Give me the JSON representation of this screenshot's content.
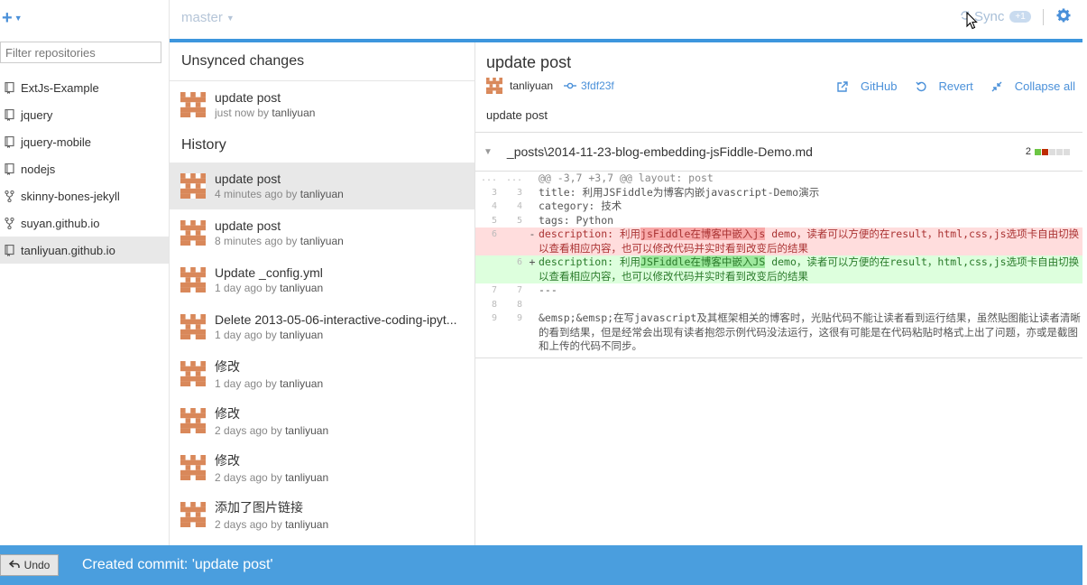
{
  "sidebar": {
    "filter_placeholder": "Filter repositories",
    "repos": [
      {
        "name": "ExtJs-Example",
        "icon": "repo-icon"
      },
      {
        "name": "jquery",
        "icon": "repo-icon"
      },
      {
        "name": "jquery-mobile",
        "icon": "repo-icon"
      },
      {
        "name": "nodejs",
        "icon": "repo-icon"
      },
      {
        "name": "skinny-bones-jekyll",
        "icon": "fork-icon"
      },
      {
        "name": "suyan.github.io",
        "icon": "fork-icon"
      },
      {
        "name": "tanliyuan.github.io",
        "icon": "repo-icon",
        "selected": true
      }
    ]
  },
  "topbar": {
    "branch": "master",
    "sync_label": "Sync",
    "sync_badge": "+1"
  },
  "middle": {
    "unsynced_title": "Unsynced changes",
    "unsynced": {
      "title": "update post",
      "time": "just now",
      "by": "by",
      "author": "tanliyuan"
    },
    "history_title": "History",
    "history": [
      {
        "title": "update post",
        "time": "4 minutes ago",
        "by": "by",
        "author": "tanliyuan",
        "selected": true
      },
      {
        "title": "update post",
        "time": "8 minutes ago",
        "by": "by",
        "author": "tanliyuan"
      },
      {
        "title": "Update _config.yml",
        "time": "1 day ago",
        "by": "by",
        "author": "tanliyuan"
      },
      {
        "title": "Delete 2013-05-06-interactive-coding-ipyt...",
        "time": "1 day ago",
        "by": "by",
        "author": "tanliyuan"
      },
      {
        "title": "修改",
        "time": "1 day ago",
        "by": "by",
        "author": "tanliyuan"
      },
      {
        "title": "修改",
        "time": "2 days ago",
        "by": "by",
        "author": "tanliyuan"
      },
      {
        "title": "修改",
        "time": "2 days ago",
        "by": "by",
        "author": "tanliyuan"
      },
      {
        "title": "添加了图片链接",
        "time": "2 days ago",
        "by": "by",
        "author": "tanliyuan"
      }
    ]
  },
  "detail": {
    "title": "update post",
    "author": "tanliyuan",
    "sha": "3fdf23f",
    "actions": {
      "github": "GitHub",
      "revert": "Revert",
      "collapse": "Collapse all"
    },
    "message": "update post",
    "file": "_posts\\2014-11-23-blog-embedding-jsFiddle-Demo.md",
    "changes": "2",
    "diff": {
      "hunk": "@@ -3,7 +3,7 @@ layout: post",
      "hunk_old": "...",
      "hunk_new": "...",
      "l3": {
        "old": "3",
        "new": "3",
        "code": "title: 利用JSFiddle为博客内嵌javascript-Demo演示"
      },
      "l4": {
        "old": "4",
        "new": "4",
        "code": "category: 技术"
      },
      "l5": {
        "old": "5",
        "new": "5",
        "code": "tags: Python"
      },
      "del": {
        "old": "6",
        "sign": "-",
        "pre": "description: 利用",
        "hl": "jsFiddle在博客中嵌入js",
        "post": " demo，读者可以方便的在result，html,css,js选项卡自由切换以查看相应内容，也可以修改代码并实时看到改变后的结果"
      },
      "add": {
        "new": "6",
        "sign": "+",
        "pre": "description: 利用",
        "hl": "JSFiddle在博客中嵌入JS",
        "post": " demo，读者可以方便的在result，html,css,js选项卡自由切换以查看相应内容，也可以修改代码并实时看到改变后的结果"
      },
      "l7": {
        "old": "7",
        "new": "7",
        "code": "---"
      },
      "l8": {
        "old": "8",
        "new": "8",
        "code": ""
      },
      "l9": {
        "old": "9",
        "new": "9",
        "code": "&emsp;&emsp;在写javascript及其框架相关的博客时，光贴代码不能让读者看到运行结果，虽然贴图能让读者清晰的看到结果，但是经常会出现有读者抱怨示例代码没法运行，这很有可能是在代码粘贴时格式上出了问题，亦或是截图和上传的代码不同步。"
      }
    }
  },
  "bottom": {
    "undo_label": "Undo",
    "message": "Created commit: 'update post'"
  },
  "colors": {
    "accent": "#3d96dd",
    "bottom_bar": "#4a9ede",
    "link": "#4a90d9"
  }
}
